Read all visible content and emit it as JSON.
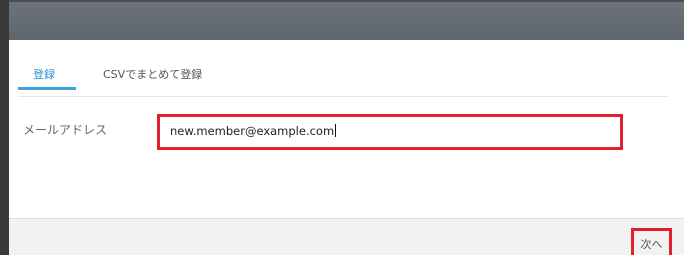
{
  "tabs": [
    {
      "label": "登録",
      "active": true
    },
    {
      "label": "CSVでまとめて登録",
      "active": false
    }
  ],
  "form": {
    "email_label": "メールアドレス",
    "email_value": "new.member@example.com"
  },
  "footer": {
    "next_label": "次へ"
  },
  "colors": {
    "accent": "#2f8fd1",
    "highlight_border": "#e0202f",
    "header": "#636970"
  }
}
